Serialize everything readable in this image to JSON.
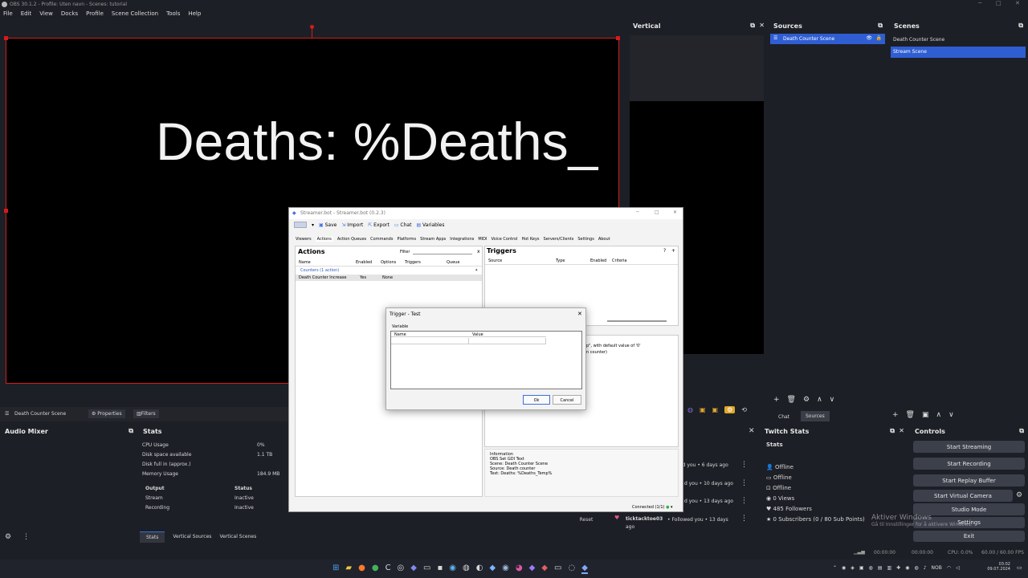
{
  "title": "OBS 30.1.2 - Profile: Uten navn - Scenes: tutorial",
  "menu": [
    "File",
    "Edit",
    "View",
    "Docks",
    "Profile",
    "Scene Collection",
    "Tools",
    "Help"
  ],
  "preview": {
    "text": "Deaths: %Deaths_"
  },
  "vertical": {
    "title": "Vertical"
  },
  "sources": {
    "title": "Sources",
    "items": [
      "Death Counter Scene"
    ]
  },
  "scenes": {
    "title": "Scenes",
    "items": [
      "Death Counter Scene",
      "Stream Scene"
    ],
    "selected": 1
  },
  "tabs_small": {
    "chat": "Chat",
    "sources": "Sources"
  },
  "context": {
    "scene": "Death Counter Scene",
    "properties": "Properties",
    "filters": "Filters"
  },
  "audio": {
    "title": "Audio Mixer"
  },
  "stats": {
    "title": "Stats",
    "rows": [
      [
        "CPU Usage",
        "0%"
      ],
      [
        "Disk space available",
        "1.1 TB"
      ],
      [
        "Disk full in (approx.)",
        ""
      ],
      [
        "Memory Usage",
        "184.9 MB"
      ]
    ],
    "out_head": [
      "Output",
      "Status"
    ],
    "out_rows": [
      [
        "Stream",
        "Inactive"
      ],
      [
        "Recording",
        "Inactive"
      ]
    ]
  },
  "bottom_tabs": [
    "Stats",
    "Vertical Sources",
    "Vertical Scenes"
  ],
  "twitch": {
    "title": "Twitch Stats",
    "sub": "Stats",
    "items": [
      "Offline",
      "Offline",
      "Offline",
      "0 Views",
      "485 Followers",
      "0 Subscribers (0 / 80 Sub Points)"
    ]
  },
  "controls": {
    "title": "Controls",
    "buttons": [
      "Start Streaming",
      "Start Recording",
      "Start Replay Buffer",
      "Start Virtual Camera",
      "Studio Mode",
      "Settings",
      "Exit"
    ]
  },
  "activity": {
    "items": [
      "ed you • 6 days ago",
      "d you • 10 days ago",
      "d you • 13 days ago"
    ],
    "last_user": "ticktacktoe03",
    "last_text": "• Followed you • 13 days ago",
    "reset": "Reset"
  },
  "watermark": {
    "line1": "Aktiver Windows",
    "line2": "Gå til Innstillinger for å aktivere Windows."
  },
  "status": {
    "t1": "00:00:00",
    "t2": "00:00:00",
    "cpu": "CPU: 0.0%",
    "fps": "60.00 / 60.00 FPS"
  },
  "taskbar": {
    "lang": "NOB",
    "time": "03:02",
    "date": "09.07.2024"
  },
  "streamerbot": {
    "title": "Streamer.bot - Streamer.bot (0.2.3)",
    "toolbar": [
      "Save",
      "Import",
      "Export",
      "Chat",
      "Variables"
    ],
    "tabs": [
      "Viewers",
      "Actions",
      "Action Queues",
      "Commands",
      "Platforms",
      "Stream Apps",
      "Integrations",
      "MIDI",
      "Voice Control",
      "Hot Keys",
      "Servers/Clients",
      "Settings",
      "About"
    ],
    "actions_title": "Actions",
    "filter": "Filter",
    "action_cols": [
      "Name",
      "Enabled",
      "Options",
      "Triggers",
      "Queue"
    ],
    "group": "Counters (1 action)",
    "action_row": [
      "Death Counter Increase",
      "Yes",
      "None"
    ],
    "triggers_title": "Triggers",
    "trigger_cols": [
      "Source",
      "Type",
      "Enabled",
      "Criteria"
    ],
    "sub_frag1": "p\", with default value of '0'",
    "sub_frag2": "n counter)",
    "info_title": "Information",
    "info": [
      "OBS Set GDI Text",
      "Scene: Death Counter Scene",
      "Source: Death counter",
      "Text: Deaths: %Deaths_Temp%"
    ],
    "connected": "Connected (1/1)"
  },
  "dialog": {
    "title": "Trigger - Test",
    "group": "Variable",
    "cols": [
      "Name",
      "Value"
    ],
    "ok": "Ok",
    "cancel": "Cancel"
  }
}
